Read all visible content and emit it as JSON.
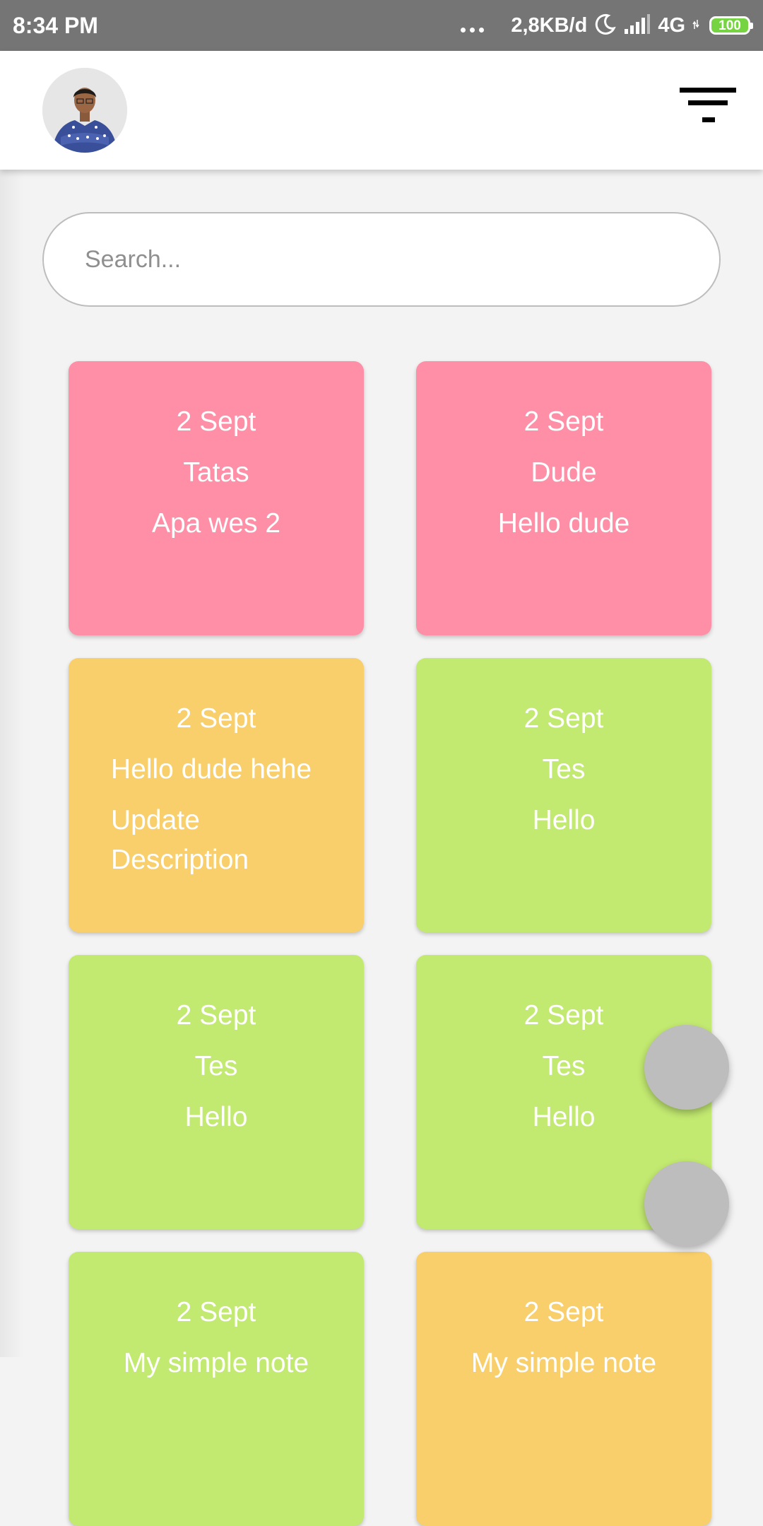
{
  "status_bar": {
    "time": "8:34 PM",
    "data_speed": "2,8KB/d",
    "network": "4G",
    "battery": "100",
    "icons": [
      "more-dots-icon",
      "moon-icon",
      "signal-icon",
      "battery-icon"
    ]
  },
  "app_bar": {
    "avatar": "profile-photo",
    "filter_icon": "filter-lines-icon"
  },
  "search": {
    "placeholder": "Search..."
  },
  "colors": {
    "pink": "#ff8fa6",
    "orange": "#f9cf6b",
    "green": "#c2e970",
    "status_bar": "#757575",
    "fab": "#bdbdbd"
  },
  "notes": [
    {
      "date": "2 Sept",
      "title": "Tatas",
      "description": "Apa wes 2",
      "color": "pink"
    },
    {
      "date": "2 Sept",
      "title": "Dude",
      "description": "Hello dude",
      "color": "pink"
    },
    {
      "date": "2 Sept",
      "title": "Hello dude hehe",
      "description": "Update Description",
      "color": "orange"
    },
    {
      "date": "2 Sept",
      "title": "Tes",
      "description": "Hello",
      "color": "green"
    },
    {
      "date": "2 Sept",
      "title": "Tes",
      "description": "Hello",
      "color": "green"
    },
    {
      "date": "2 Sept",
      "title": "Tes",
      "description": "Hello",
      "color": "green"
    },
    {
      "date": "2 Sept",
      "title": "My simple note",
      "description": "",
      "color": "green"
    },
    {
      "date": "2 Sept",
      "title": "My simple note",
      "description": "",
      "color": "orange"
    }
  ]
}
